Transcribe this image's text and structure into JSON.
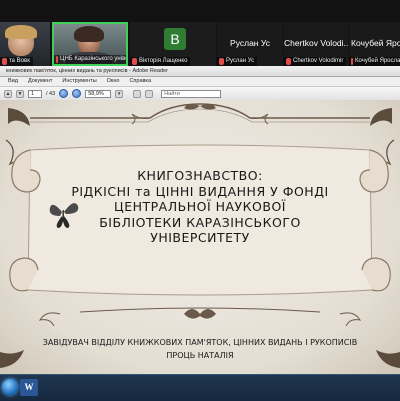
{
  "zoom": {
    "participants": [
      {
        "name": "та Вовк",
        "muted": true,
        "has_video": true
      },
      {
        "name": "ЦНБ Каразінського універ...",
        "muted": true,
        "has_video": true,
        "active_speaker": true
      },
      {
        "name": "Вікторія Лащенко",
        "muted": true,
        "has_video": false,
        "avatar_letter": "В",
        "avatar_color": "#2e7d32"
      },
      {
        "name": "Руслан Ус",
        "muted": true,
        "has_video": false,
        "caption": "Руслан Ус"
      },
      {
        "name": "Chertkov Volodimir",
        "muted": true,
        "has_video": false,
        "caption": "Chertkov Volodi..."
      },
      {
        "name": "Кочубей Ярослав",
        "muted": true,
        "has_video": false,
        "caption": "Кочубей Яросл..."
      }
    ]
  },
  "reader": {
    "window_title": "книжкових пам'яток, цінних видань та рукописів - Adobe Reader",
    "menu": [
      "Вид",
      "Документ",
      "Инструменты",
      "Окно",
      "Справка"
    ],
    "page_current": "1",
    "page_total": "/ 43",
    "zoom": "58,9%",
    "find_placeholder": "Найти"
  },
  "slide": {
    "title_lines": [
      "КНИГОЗНАВСТВО:",
      "РІДКІСНІ та ЦІННІ ВИДАННЯ У ФОНДІ",
      "ЦЕНТРАЛЬНОЇ НАУКОВОЇ",
      "БІБЛІОТЕКИ КАРАЗІНСЬКОГО",
      "УНІВЕРСИТЕТУ"
    ],
    "subtitle_lines": [
      "ЗАВІДУВАЧ ВІДДІЛУ КНИЖКОВИХ ПАМ'ЯТОК, ЦІННИХ ВИДАНЬ І РУКОПИСІВ",
      "ПРОЦЬ НАТАЛІЯ"
    ]
  },
  "taskbar": {
    "apps": [
      {
        "icon": "windows-start-icon"
      },
      {
        "icon": "word-icon",
        "letter": "W"
      }
    ]
  }
}
